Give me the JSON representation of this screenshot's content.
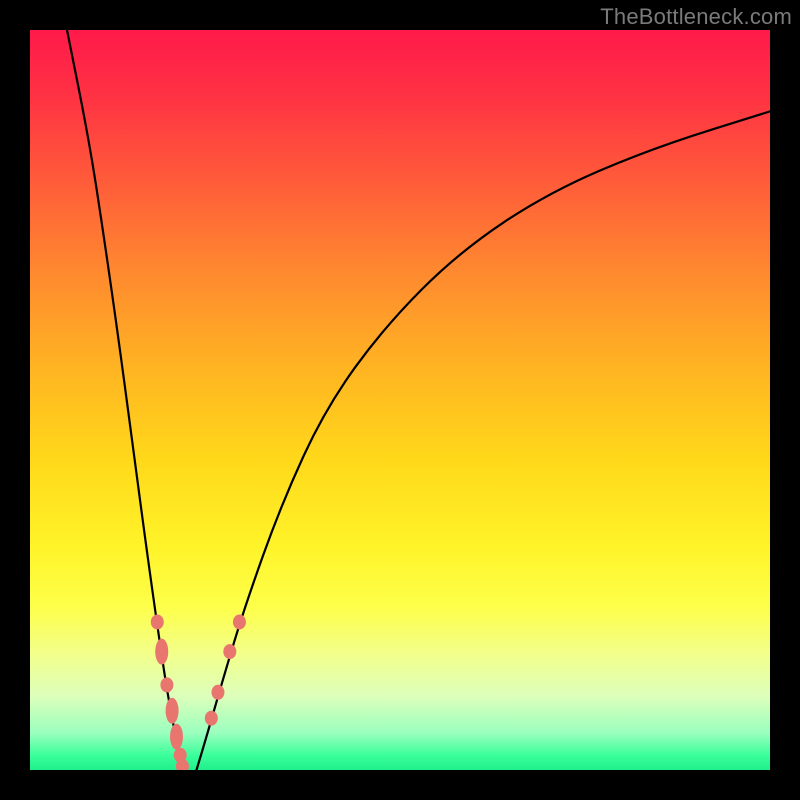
{
  "watermark": "TheBottleneck.com",
  "colors": {
    "frame": "#000000",
    "curve": "#000000",
    "marker": "#e8766f"
  },
  "chart_data": {
    "type": "line",
    "title": "",
    "xlabel": "",
    "ylabel": "",
    "xlim": [
      0,
      100
    ],
    "ylim": [
      0,
      100
    ],
    "grid": false,
    "legend": false,
    "series": [
      {
        "name": "left-curve",
        "x": [
          5,
          8,
          10,
          12,
          14,
          16,
          18,
          19,
          20,
          20.6
        ],
        "y": [
          100,
          85,
          72,
          58,
          43,
          28,
          14,
          8,
          3,
          0
        ]
      },
      {
        "name": "right-curve",
        "x": [
          22.5,
          24,
          26,
          29,
          34,
          40,
          48,
          58,
          70,
          84,
          100
        ],
        "y": [
          0,
          5,
          12,
          22,
          36,
          49,
          60,
          70,
          78,
          84,
          89
        ]
      }
    ],
    "markers": [
      {
        "curve": "left",
        "x": 17.2,
        "y": 20.0,
        "len": 1
      },
      {
        "curve": "left",
        "x": 17.8,
        "y": 16.0,
        "len": 2
      },
      {
        "curve": "left",
        "x": 18.5,
        "y": 11.5,
        "len": 1
      },
      {
        "curve": "left",
        "x": 19.2,
        "y": 8.0,
        "len": 2
      },
      {
        "curve": "left",
        "x": 19.8,
        "y": 4.5,
        "len": 2
      },
      {
        "curve": "left",
        "x": 20.3,
        "y": 2.0,
        "len": 1
      },
      {
        "curve": "left",
        "x": 20.6,
        "y": 0.5,
        "len": 1
      },
      {
        "curve": "right",
        "x": 24.5,
        "y": 7.0,
        "len": 1
      },
      {
        "curve": "right",
        "x": 25.4,
        "y": 10.5,
        "len": 1
      },
      {
        "curve": "right",
        "x": 27.0,
        "y": 16.0,
        "len": 1
      },
      {
        "curve": "right",
        "x": 28.3,
        "y": 20.0,
        "len": 1
      }
    ],
    "notes": "V-shaped bottleneck curve; x/y are percentages of the inner plot area (origin bottom-left). Values are estimated from pixel positions since the chart has no axes or tick labels."
  }
}
